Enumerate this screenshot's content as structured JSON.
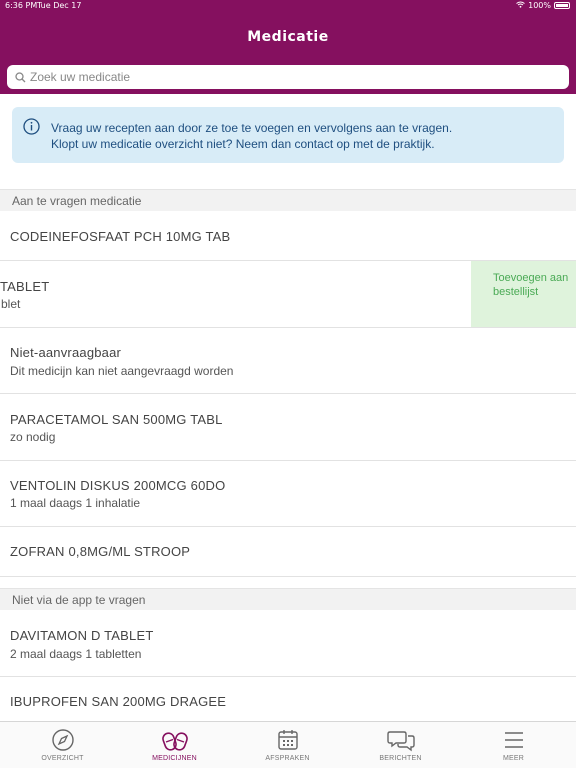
{
  "status_bar": {
    "time": "6:36 PM",
    "date": "Tue Dec 17",
    "battery": "100%"
  },
  "header": {
    "title": "Medicatie"
  },
  "search": {
    "placeholder": "Zoek uw medicatie"
  },
  "info": {
    "line1": "Vraag uw recepten aan door ze toe te voegen en vervolgens aan te vragen.",
    "line2": "Klopt uw medicatie overzicht niet? Neem dan contact op met de praktijk."
  },
  "sections": [
    {
      "header": "Aan te vragen medicatie",
      "items": [
        {
          "title": "CODEINEFOSFAAT PCH 10MG TAB",
          "sub": ""
        },
        {
          "title": "TABLET",
          "sub": "blet",
          "action": "Toevoegen aan bestellijst"
        },
        {
          "title": "Niet-aanvraagbaar",
          "sub": "Dit medicijn kan niet aangevraagd worden"
        },
        {
          "title": "PARACETAMOL SAN 500MG TABL",
          "sub": "zo nodig"
        },
        {
          "title": "VENTOLIN DISKUS 200MCG 60DO",
          "sub": "1 maal daags 1 inhalatie"
        },
        {
          "title": "ZOFRAN 0,8MG/ML STROOP",
          "sub": ""
        }
      ]
    },
    {
      "header": "Niet via de app te vragen",
      "items": [
        {
          "title": "DAVITAMON D TABLET",
          "sub": "2 maal daags 1 tabletten"
        },
        {
          "title": "IBUPROFEN SAN 200MG DRAGEE",
          "sub": ""
        }
      ]
    }
  ],
  "tabs": [
    {
      "label": "OVERZICHT",
      "icon": "compass-icon",
      "active": false
    },
    {
      "label": "MEDICIJNEN",
      "icon": "pills-icon",
      "active": true
    },
    {
      "label": "AFSPRAKEN",
      "icon": "calendar-icon",
      "active": false
    },
    {
      "label": "BERICHTEN",
      "icon": "chat-bubbles-icon",
      "active": false
    },
    {
      "label": "MEER",
      "icon": "menu-icon",
      "active": false
    }
  ],
  "colors": {
    "brand": "#85105f",
    "info_bg": "#d8ecf7",
    "info_text": "#1f4f80",
    "action_bg": "#dff3dc",
    "action_text": "#4aaa55"
  }
}
